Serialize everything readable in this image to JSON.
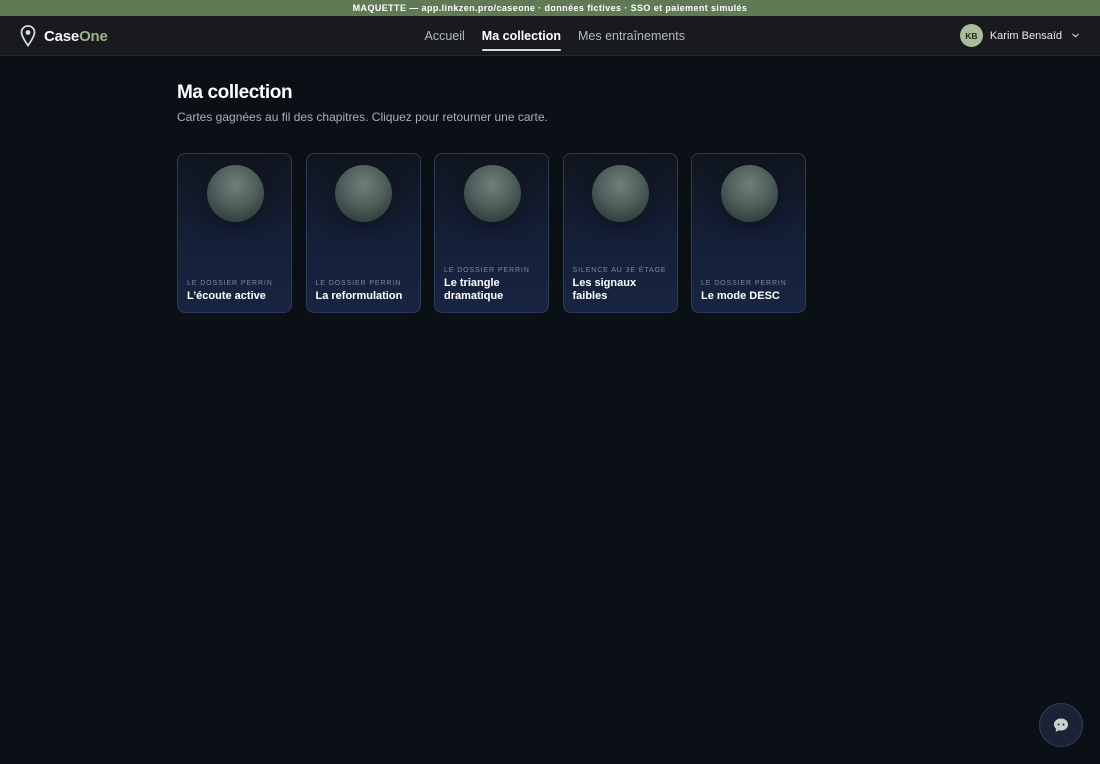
{
  "banner": {
    "text": "MAQUETTE — app.linkzen.pro/caseone · données fictives · SSO et paiement simulés"
  },
  "brand": {
    "name_part1": "Case",
    "name_part2": "One",
    "logo_icon": "map-pin-icon",
    "accent_color": "#9cb48c"
  },
  "nav": {
    "items": [
      {
        "label": "Accueil",
        "active": false
      },
      {
        "label": "Ma collection",
        "active": true
      },
      {
        "label": "Mes entraînements",
        "active": false
      }
    ]
  },
  "user": {
    "initials": "KB",
    "name": "Karim Bensaïd",
    "menu_icon": "chevron-down-icon"
  },
  "page": {
    "title": "Ma collection",
    "subtitle": "Cartes gagnées au fil des chapitres. Cliquez pour retourner une carte."
  },
  "cards": [
    {
      "chapter": "LE DOSSIER PERRIN",
      "title": "L’écoute active"
    },
    {
      "chapter": "LE DOSSIER PERRIN",
      "title": "La reformulation"
    },
    {
      "chapter": "LE DOSSIER PERRIN",
      "title": "Le triangle dramatique"
    },
    {
      "chapter": "SILENCE AU 3E ÉTAGE",
      "title": "Les signaux faibles"
    },
    {
      "chapter": "LE DOSSIER PERRIN",
      "title": "Le mode DESC"
    }
  ],
  "chat": {
    "icon": "chat-bot-icon"
  },
  "colors": {
    "banner_bg": "#5f7a55",
    "page_bg": "#0b0f16",
    "topbar_bg": "#181a1d",
    "card_border": "#2c3a55"
  }
}
